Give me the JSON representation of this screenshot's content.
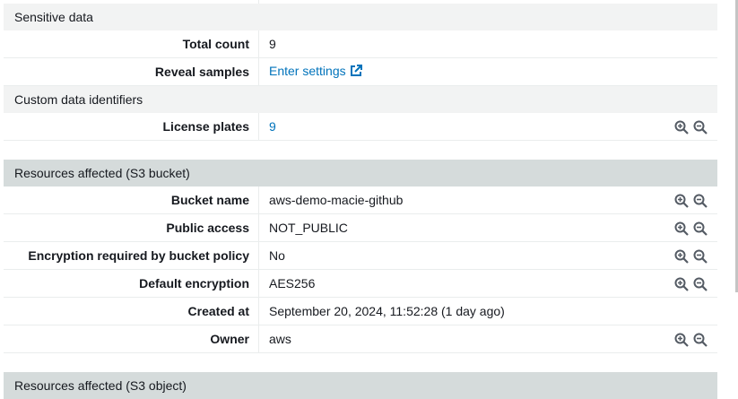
{
  "sections": {
    "sensitive_data": "Sensitive data",
    "custom_identifiers": "Custom data identifiers",
    "resources_bucket": "Resources affected (S3 bucket)",
    "resources_object": "Resources affected (S3 object)"
  },
  "sensitive": {
    "total_count_label": "Total count",
    "total_count_value": "9",
    "reveal_samples_label": "Reveal samples",
    "reveal_samples_value": "Enter settings"
  },
  "custom": {
    "license_plates_label": "License plates",
    "license_plates_value": "9"
  },
  "bucket": {
    "name_label": "Bucket name",
    "name_value": "aws-demo-macie-github",
    "public_access_label": "Public access",
    "public_access_value": "NOT_PUBLIC",
    "encryption_policy_label": "Encryption required by bucket policy",
    "encryption_policy_value": "No",
    "default_encryption_label": "Default encryption",
    "default_encryption_value": "AES256",
    "created_at_label": "Created at",
    "created_at_value": "September 20, 2024, 11:52:28 (1 day ago)",
    "owner_label": "Owner",
    "owner_value": "aws"
  },
  "icons": {
    "zoom_in": "zoom-in-icon",
    "zoom_out": "zoom-out-icon",
    "external_link": "external-link-icon"
  },
  "colors": {
    "link": "#0073bb",
    "section_light": "#f2f3f3",
    "section_dark": "#d5dbdb"
  }
}
